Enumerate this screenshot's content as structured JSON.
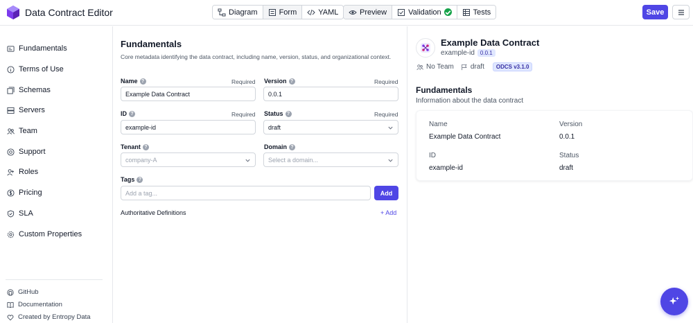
{
  "app": {
    "title": "Data Contract Editor"
  },
  "header": {
    "view_modes": [
      {
        "label": "Diagram",
        "icon": "diagram-icon"
      },
      {
        "label": "Form",
        "icon": "form-icon"
      },
      {
        "label": "YAML",
        "icon": "code-icon"
      }
    ],
    "panels": [
      {
        "label": "Preview",
        "icon": "eye-icon"
      },
      {
        "label": "Validation",
        "icon": "validation-icon"
      },
      {
        "label": "Tests",
        "icon": "tests-icon"
      }
    ],
    "save_label": "Save",
    "accent": "#4f46e5"
  },
  "sidebar": {
    "items": [
      {
        "label": "Fundamentals",
        "icon": "id-card-icon"
      },
      {
        "label": "Terms of Use",
        "icon": "info-icon"
      },
      {
        "label": "Schemas",
        "icon": "schemas-icon"
      },
      {
        "label": "Servers",
        "icon": "server-icon"
      },
      {
        "label": "Team",
        "icon": "team-icon"
      },
      {
        "label": "Support",
        "icon": "support-icon"
      },
      {
        "label": "Roles",
        "icon": "roles-icon"
      },
      {
        "label": "Pricing",
        "icon": "pricing-icon"
      },
      {
        "label": "SLA",
        "icon": "shield-icon"
      },
      {
        "label": "Custom Properties",
        "icon": "gear-icon"
      }
    ],
    "footer": [
      {
        "label": "GitHub",
        "icon": "github-icon"
      },
      {
        "label": "Documentation",
        "icon": "book-icon"
      },
      {
        "label": "Created by Entropy Data",
        "icon": "heart-icon"
      }
    ]
  },
  "form": {
    "title": "Fundamentals",
    "description": "Core metadata identifying the data contract, including name, version, status, and organizational context.",
    "required_text": "Required",
    "name": {
      "label": "Name",
      "value": "Example Data Contract"
    },
    "version": {
      "label": "Version",
      "value": "0.0.1"
    },
    "id": {
      "label": "ID",
      "value": "example-id"
    },
    "status": {
      "label": "Status",
      "value": "draft"
    },
    "tenant": {
      "label": "Tenant",
      "placeholder": "company-A"
    },
    "domain": {
      "label": "Domain",
      "placeholder": "Select a domain..."
    },
    "tags": {
      "label": "Tags",
      "placeholder": "Add a tag...",
      "add_label": "Add"
    },
    "authoritative": {
      "label": "Authoritative Definitions",
      "add_label": "+ Add"
    }
  },
  "preview": {
    "title": "Example Data Contract",
    "id": "example-id",
    "version": "0.0.1",
    "team": "No Team",
    "status": "draft",
    "standard": "ODCS v3.1.0",
    "section_title": "Fundamentals",
    "section_desc": "Information about the data contract",
    "fields": {
      "name_key": "Name",
      "name_value": "Example Data Contract",
      "version_key": "Version",
      "version_value": "0.0.1",
      "id_key": "ID",
      "id_value": "example-id",
      "status_key": "Status",
      "status_value": "draft"
    }
  }
}
